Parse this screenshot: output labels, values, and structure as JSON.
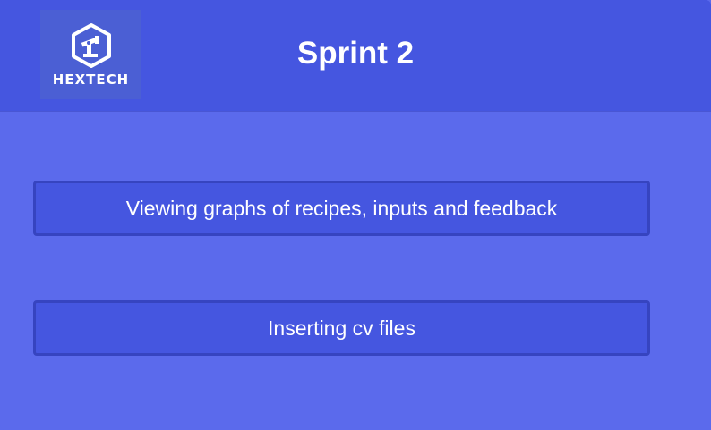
{
  "header": {
    "logo_text": "HEXTECH",
    "title": "Sprint 2"
  },
  "actions": [
    {
      "label": "Viewing graphs of recipes, inputs and feedback"
    },
    {
      "label": "Inserting cv files"
    }
  ],
  "colors": {
    "background": "#5b6aec",
    "header": "#4556e0",
    "button": "#4556e0",
    "button_border": "#3644c0",
    "text": "#ffffff"
  },
  "icons": {
    "logo": "hexagon-robot-arm-icon"
  }
}
